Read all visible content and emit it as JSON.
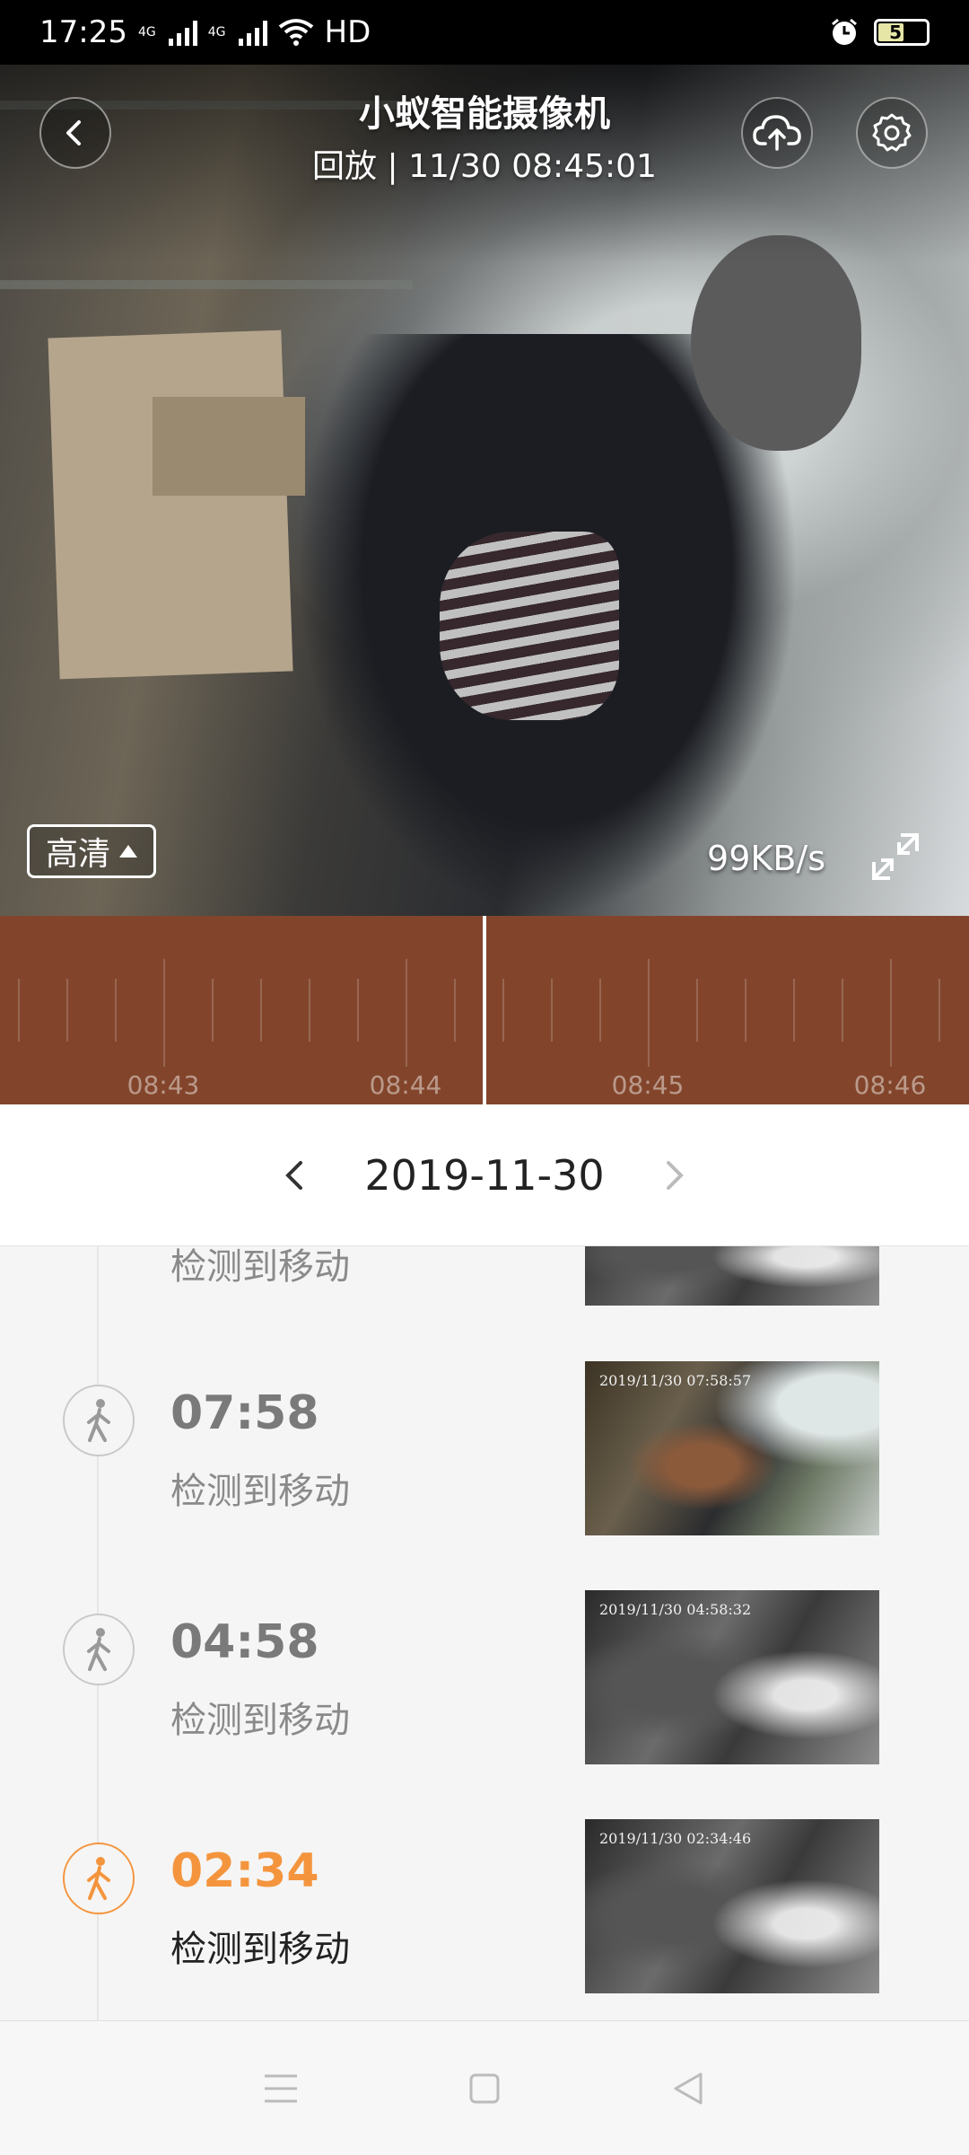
{
  "status_bar": {
    "time": "17:25",
    "net1": "4G",
    "net2": "4G",
    "hd": "HD",
    "battery": "51"
  },
  "header": {
    "title": "小蚁智能摄像机",
    "subtitle": "回放 | 11/30 08:45:01",
    "icons": [
      "back-icon",
      "cloud-upload-icon",
      "settings-icon"
    ]
  },
  "player": {
    "quality": "高清",
    "speed": "99KB/s",
    "exit_fullscreen_icon": "exit-fullscreen-icon"
  },
  "timeline": {
    "labels": [
      "08:43",
      "08:44",
      "08:45",
      "08:46"
    ],
    "colors": {
      "track": "#82452b",
      "playhead": "#ffffff"
    }
  },
  "date_nav": {
    "date": "2019-11-30"
  },
  "events": [
    {
      "time": "",
      "desc": "检测到移动",
      "thumb_stamp": ""
    },
    {
      "time": "07:58",
      "desc": "检测到移动",
      "thumb_stamp": "2019/11/30 07:58:57"
    },
    {
      "time": "04:58",
      "desc": "检测到移动",
      "thumb_stamp": "2019/11/30 04:58:32"
    },
    {
      "time": "02:34",
      "desc": "检测到移动",
      "thumb_stamp": "2019/11/30 02:34:46"
    }
  ],
  "accent_color": "#f4953e",
  "bottom_nav": [
    "menu-icon",
    "home-icon",
    "back-nav-icon"
  ]
}
